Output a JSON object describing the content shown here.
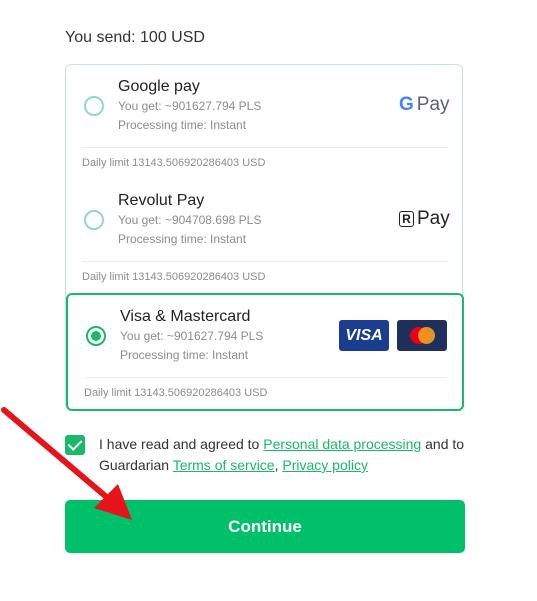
{
  "send": {
    "label": "You send: 100 USD"
  },
  "methods": [
    {
      "name": "Google pay",
      "you_get": "You get: ~901627.794 PLS",
      "processing": "Processing time: Instant",
      "daily_limit": "Daily limit 13143.506920286403 USD",
      "logo_icon": "google-pay-icon",
      "logo_letter": "G",
      "logo_text": "Pay",
      "selected": false
    },
    {
      "name": "Revolut Pay",
      "you_get": "You get: ~904708.698 PLS",
      "processing": "Processing time: Instant",
      "daily_limit": "Daily limit 13143.506920286403 USD",
      "logo_icon": "revolut-pay-icon",
      "logo_letter": "R",
      "logo_text": "Pay",
      "selected": false
    },
    {
      "name": "Visa & Mastercard",
      "you_get": "You get: ~901627.794 PLS",
      "processing": "Processing time: Instant",
      "daily_limit": "Daily limit 13143.506920286403 USD",
      "logo_icon": "visa-mastercard-icon",
      "visa_text": "VISA",
      "selected": true
    }
  ],
  "agreement": {
    "checked": true,
    "text_1": "I have read and agreed to ",
    "link_personal": "Personal data processing",
    "text_2": " and to Guardarian ",
    "link_terms": "Terms of service",
    "text_3": ", ",
    "link_privacy": "Privacy policy"
  },
  "continue_label": "Continue",
  "colors": {
    "accent": "#00c16a",
    "radio_border": "#8fdcbc",
    "arrow": "#e5141b"
  }
}
